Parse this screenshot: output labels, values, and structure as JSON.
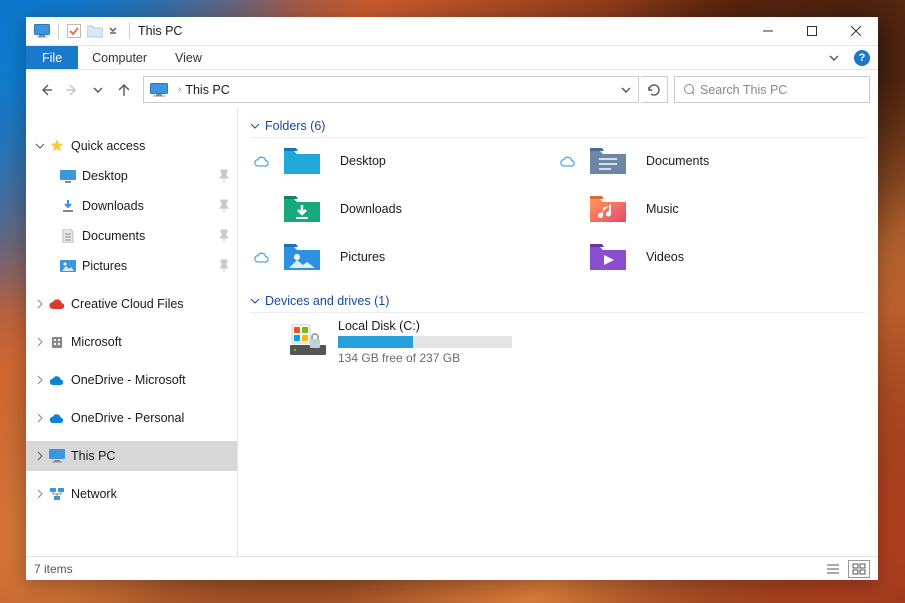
{
  "title": "This PC",
  "ribbon": {
    "file": "File",
    "computer": "Computer",
    "view": "View"
  },
  "address": {
    "location": "This PC"
  },
  "search": {
    "placeholder": "Search This PC"
  },
  "tree": {
    "quick_access": {
      "label": "Quick access"
    },
    "desktop": {
      "label": "Desktop"
    },
    "downloads": {
      "label": "Downloads"
    },
    "documents": {
      "label": "Documents"
    },
    "pictures": {
      "label": "Pictures"
    },
    "ccf": {
      "label": "Creative Cloud Files"
    },
    "microsoft": {
      "label": "Microsoft"
    },
    "od_ms": {
      "label": "OneDrive - Microsoft"
    },
    "od_personal": {
      "label": "OneDrive - Personal"
    },
    "this_pc": {
      "label": "This PC"
    },
    "network": {
      "label": "Network"
    }
  },
  "sections": {
    "folders": {
      "label": "Folders (6)"
    },
    "drives": {
      "label": "Devices and drives (1)"
    }
  },
  "folders": {
    "desktop": "Desktop",
    "documents": "Documents",
    "downloads": "Downloads",
    "music": "Music",
    "pictures": "Pictures",
    "videos": "Videos"
  },
  "drive": {
    "name": "Local Disk (C:)",
    "free": "134 GB free of 237 GB",
    "fill_percent": 43
  },
  "status": {
    "items": "7 items"
  }
}
